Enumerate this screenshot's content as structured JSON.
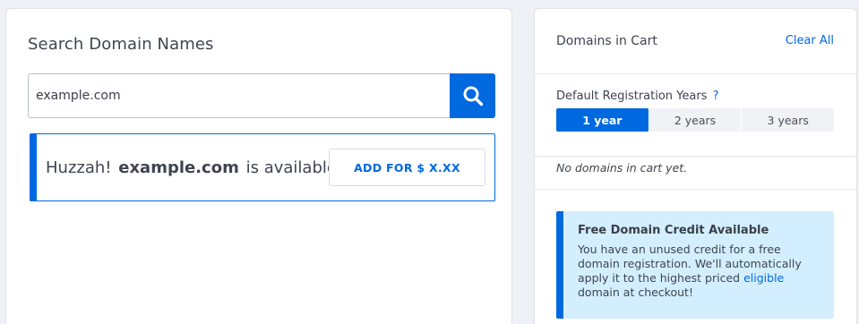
{
  "search": {
    "title": "Search Domain Names",
    "input_value": "example.com",
    "result_prefix": "Huzzah!",
    "result_domain": "example.com",
    "result_suffix": "is available!",
    "add_button_label": "ADD FOR $ X.XX"
  },
  "cart": {
    "title": "Domains in Cart",
    "clear_label": "Clear All",
    "years_label": "Default Registration Years",
    "years_help": "?",
    "years_options": [
      "1 year",
      "2 years",
      "3 years"
    ],
    "years_selected": "1 year",
    "empty_text": "No domains in cart yet."
  },
  "credit": {
    "title": "Free Domain Credit Available",
    "body_before": "You have an unused credit for a free domain registration. We'll automatically apply it to the highest priced",
    "link_text": "eligible",
    "body_after": "domain at checkout!"
  },
  "colors": {
    "accent": "#0069e0",
    "credit_bg": "#d3efff",
    "page_bg": "#eef1f6"
  },
  "icons": {
    "search": "search-icon"
  }
}
